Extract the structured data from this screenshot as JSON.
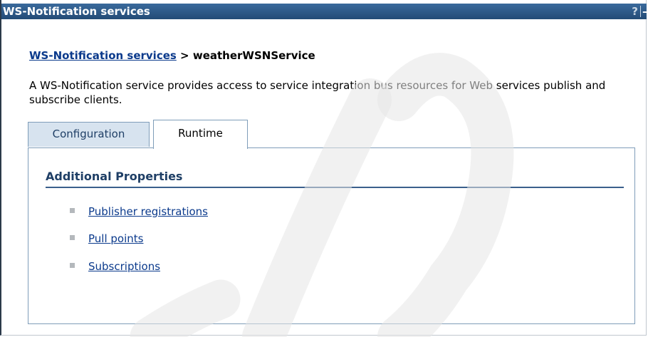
{
  "window": {
    "title": "WS-Notification services",
    "help_glyph": "?",
    "minimize_glyph": "–"
  },
  "breadcrumb": {
    "parent_link": "WS-Notification services",
    "separator": ">",
    "current": "weatherWSNService"
  },
  "description": "A WS-Notification service provides access to service integration bus resources for Web services publish and subscribe clients.",
  "tabs": [
    {
      "label": "Configuration",
      "selected": false
    },
    {
      "label": "Runtime",
      "selected": true
    }
  ],
  "additional_properties": {
    "heading": "Additional Properties",
    "links": [
      {
        "label": "Publisher registrations"
      },
      {
        "label": "Pull points"
      },
      {
        "label": "Subscriptions"
      }
    ]
  },
  "colors": {
    "titlebar": "#2f5b8a",
    "link": "#0b3a8c",
    "tab_inactive_bg": "#d7e3ef",
    "section_rule": "#3a5f8c"
  }
}
